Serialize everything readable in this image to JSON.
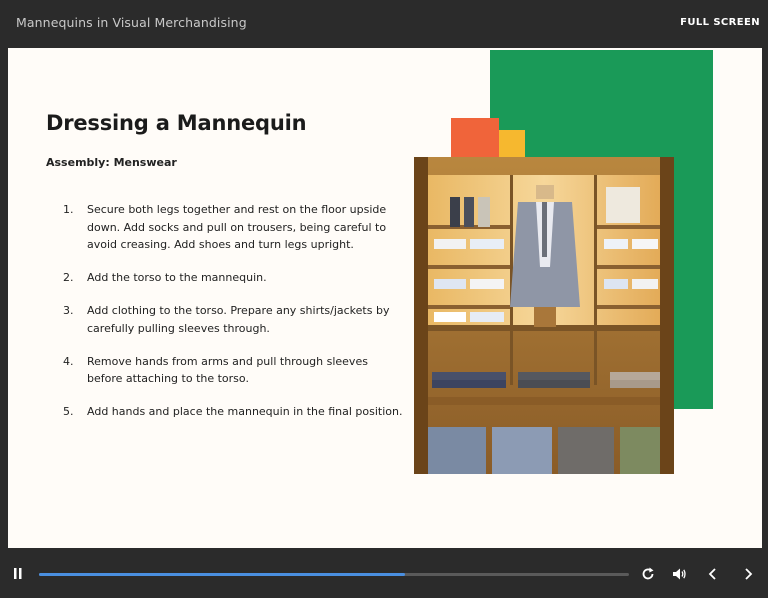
{
  "header": {
    "course_title": "Mannequins in Visual Merchandising",
    "fullscreen_label": "FULL SCREEN"
  },
  "slide": {
    "title": "Dressing a Mannequin",
    "subtitle": "Assembly: Menswear",
    "steps": [
      {
        "number": "1.",
        "text": "Secure both legs together and rest on the floor upside down. Add socks and pull on trousers, being careful to avoid creasing. Add shoes and turn legs upright."
      },
      {
        "number": "2.",
        "text": "Add the torso to the mannequin."
      },
      {
        "number": "3.",
        "text": "Add clothing to the torso. Prepare any shirts/jackets by carefully pulling sleeves through."
      },
      {
        "number": "4.",
        "text": "Remove hands from arms and pull through sleeves before attaching to the torso."
      },
      {
        "number": "5.",
        "text": "Add hands and place the mannequin in the final position."
      }
    ]
  },
  "player": {
    "progress": 0.62,
    "controls": [
      "pause-icon",
      "replay-icon",
      "volume-icon",
      "previous-icon",
      "next-icon"
    ]
  },
  "colors": {
    "accent_green": "#1a9a58",
    "accent_yellow": "#f6b82f",
    "accent_orange": "#f0643a",
    "progress": "#4a8fe0"
  }
}
